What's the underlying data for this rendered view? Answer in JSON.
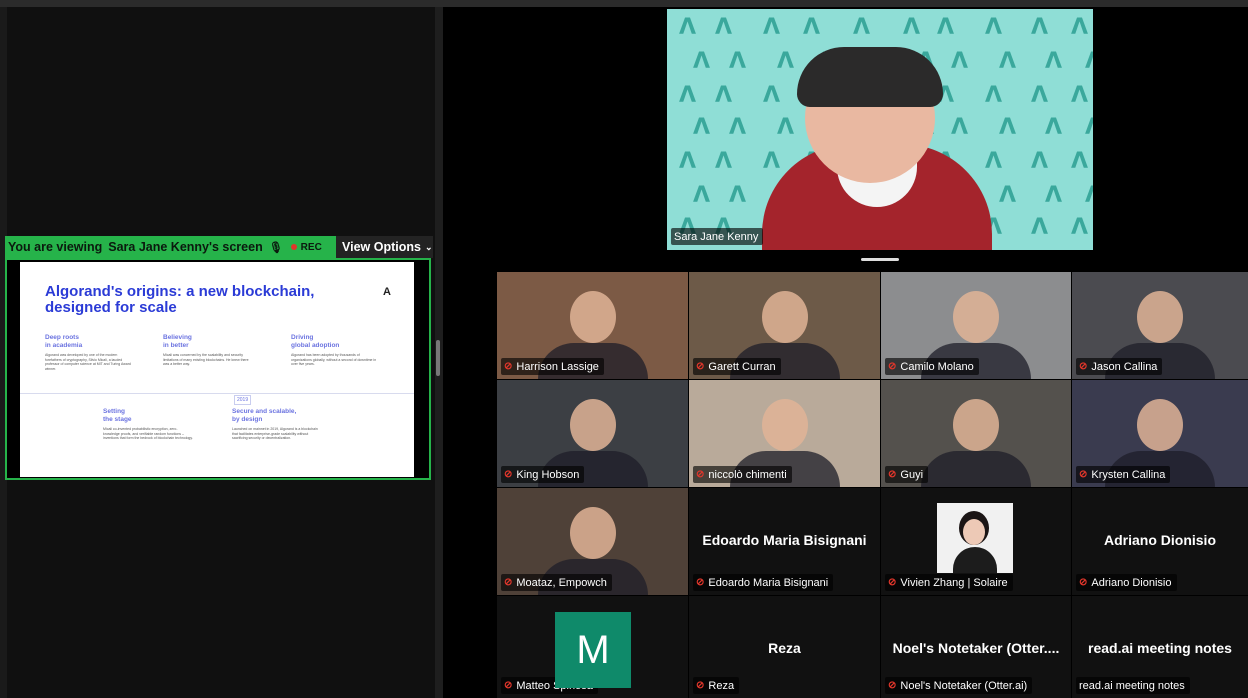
{
  "share_bar": {
    "viewing_prefix": "You are viewing",
    "viewing_name": "Sara Jane Kenny's screen",
    "rec_label": "REC",
    "view_options_label": "View Options"
  },
  "slide": {
    "title": "Algorand's origins: a new blockchain, designed for scale",
    "logo": "A",
    "columns": [
      {
        "heading": "Deep roots\nin academia",
        "body": "Algorand was developed by one of the modern forefathers of cryptography, Silvio Micali, a lauded professor of computer science at MIT and Turing Award winner."
      },
      {
        "heading": "Believing\nin better",
        "body": "Micali was concerned by the scalability and security limitations of many existing blockchains. He knew there was a better way."
      },
      {
        "heading": "Driving\nglobal adoption",
        "body": "Algorand has been adopted by thousands of organizations globally, without a second of downtime in over five years."
      },
      {
        "heading": "Setting\nthe stage",
        "body": "Micali co-invented probabilistic encryption, zero-knowledge proofs, and verifiable random functions – inventions that form the bedrock of blockchain technology."
      },
      {
        "heading": "Secure and scalable,\nby design",
        "body": "Launched on mainnet in 2019, Algorand is a blockchain that facilitates enterprise-grade scalability without sacrificing security or decentralization."
      }
    ],
    "year": "2019"
  },
  "speaker": {
    "name": "Sara Jane Kenny"
  },
  "participants": [
    {
      "name": "Harrison Lassige",
      "color": "#7c5a45"
    },
    {
      "name": "Garett Curran",
      "color": "#6d5a48"
    },
    {
      "name": "Camilo Molano",
      "color": "#8c8d8f"
    },
    {
      "name": "Jason Callina",
      "color": "#4b4b50"
    },
    {
      "name": "King Hobson",
      "color": "#3c3f44"
    },
    {
      "name": "niccolò chimenti",
      "color": "#b9aa9a"
    },
    {
      "name": "Guyi",
      "color": "#54514d"
    },
    {
      "name": "Krysten Callina",
      "color": "#3a3b4f"
    },
    {
      "name": "Moataz, Empowch",
      "color": "#4f4138"
    },
    {
      "name": "Edoardo Maria Bisignani",
      "color": "#111111",
      "display_name": "Edoardo Maria Bisignani"
    },
    {
      "name": "Vivien Zhang | Solaire",
      "color": "#111111"
    },
    {
      "name": "Adriano Dionisio",
      "color": "#111111",
      "display_name": "Adriano Dionisio"
    },
    {
      "name": "Matteo Spinosa",
      "color": "#111111",
      "avatar_letter": "M",
      "avatar_color": "#0f8a6a"
    },
    {
      "name": "Reza",
      "color": "#111111",
      "display_name": "Reza"
    },
    {
      "name": "Noel's Notetaker (Otter.ai)",
      "color": "#111111",
      "display_name": "Noel's Notetaker (Otter...."
    },
    {
      "name": "read.ai meeting notes",
      "color": "#111111",
      "display_name": "read.ai meeting notes",
      "muted": false
    }
  ]
}
